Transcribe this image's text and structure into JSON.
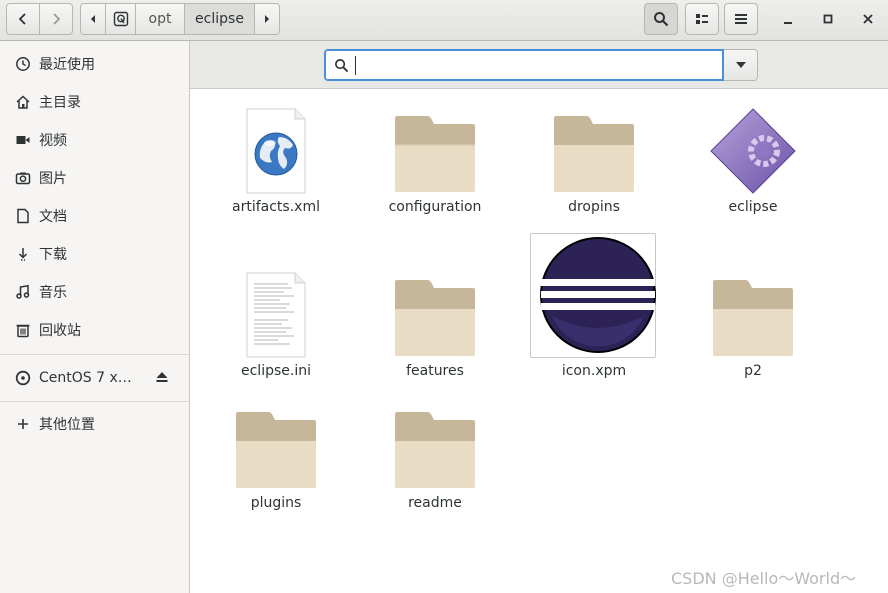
{
  "header": {
    "path": [
      "opt",
      "eclipse"
    ]
  },
  "sidebar": {
    "items": [
      {
        "label": "最近使用",
        "icon": "recent-icon"
      },
      {
        "label": "主目录",
        "icon": "home-icon"
      },
      {
        "label": "视频",
        "icon": "video-icon"
      },
      {
        "label": "图片",
        "icon": "image-icon"
      },
      {
        "label": "文档",
        "icon": "document-icon"
      },
      {
        "label": "下载",
        "icon": "download-icon"
      },
      {
        "label": "音乐",
        "icon": "music-icon"
      },
      {
        "label": "回收站",
        "icon": "trash-icon"
      }
    ],
    "devices": [
      {
        "label": "CentOS 7 x…",
        "icon": "disc-icon"
      }
    ],
    "other": {
      "label": "其他位置",
      "icon": "plus-icon"
    }
  },
  "search": {
    "value": "",
    "placeholder": ""
  },
  "files": [
    {
      "name": "artifacts.xml",
      "type": "xml-file"
    },
    {
      "name": "configuration",
      "type": "folder"
    },
    {
      "name": "dropins",
      "type": "folder"
    },
    {
      "name": "eclipse",
      "type": "executable"
    },
    {
      "name": "eclipse.ini",
      "type": "text-file"
    },
    {
      "name": "features",
      "type": "folder"
    },
    {
      "name": "icon.xpm",
      "type": "image-file"
    },
    {
      "name": "p2",
      "type": "folder"
    },
    {
      "name": "plugins",
      "type": "folder"
    },
    {
      "name": "readme",
      "type": "folder"
    }
  ],
  "watermark": "CSDN @Hello～World～",
  "colors": {
    "accent": "#4a90d9",
    "folder": "#e8dcc4",
    "folder_tab": "#c6b79b",
    "eclipse_purple": "#2c2255",
    "eclipse_orange": "#f7941e"
  }
}
